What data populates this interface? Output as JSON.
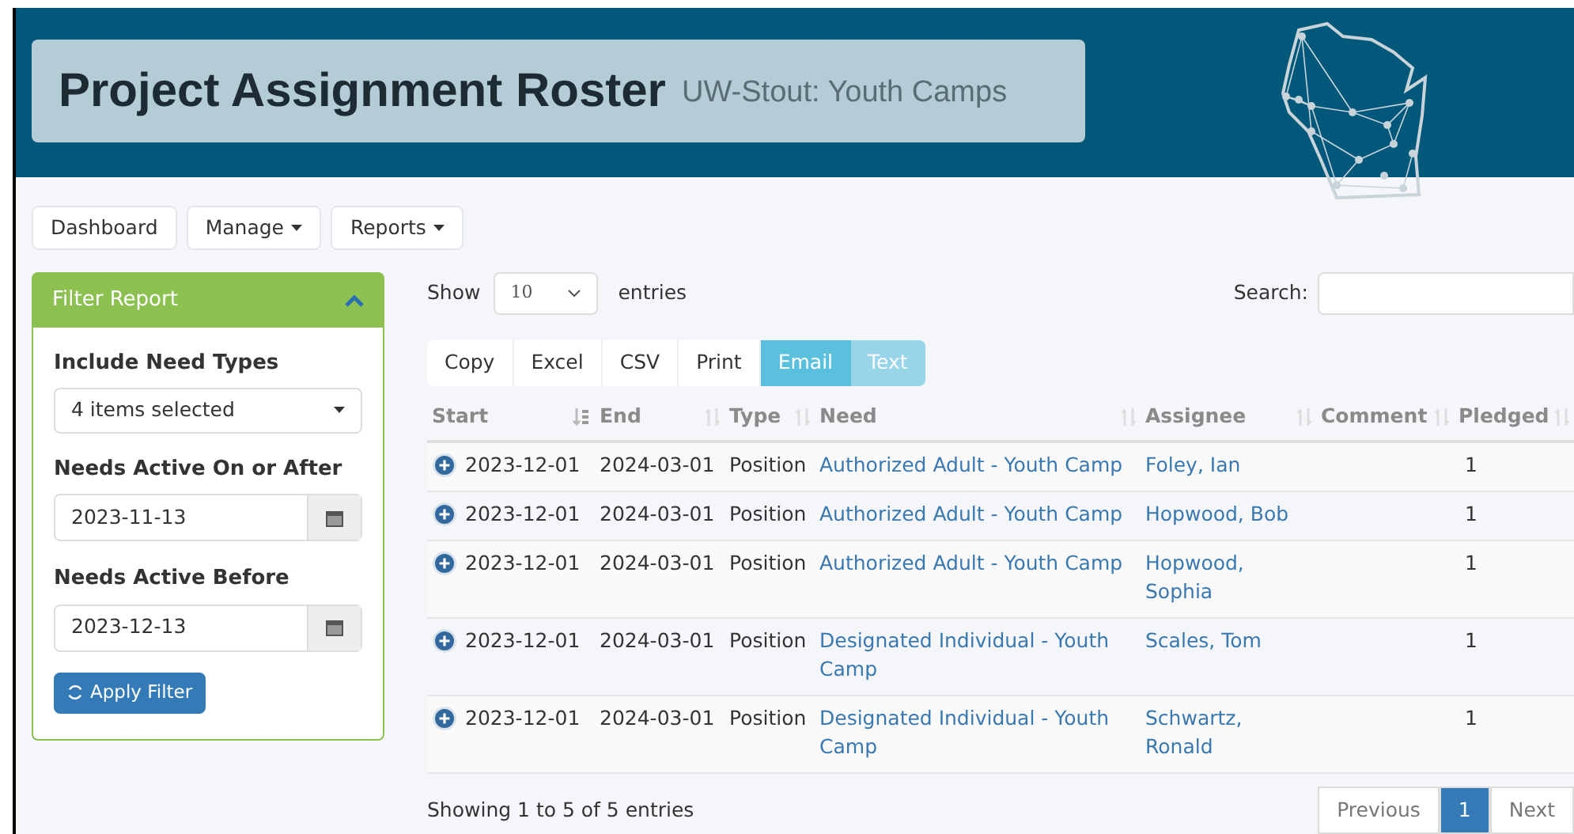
{
  "header": {
    "title": "Project Assignment Roster",
    "subtitle": "UW-Stout: Youth Camps"
  },
  "nav": [
    {
      "label": "Dashboard",
      "dropdown": false
    },
    {
      "label": "Manage",
      "dropdown": true
    },
    {
      "label": "Reports",
      "dropdown": true
    }
  ],
  "filter": {
    "title": "Filter Report",
    "expanded": true,
    "need_types_label": "Include Need Types",
    "need_types_value": "4 items selected",
    "after_label": "Needs Active On or After",
    "after_value": "2023-11-13",
    "before_label": "Needs Active Before",
    "before_value": "2023-12-13",
    "apply_button": "Apply Filter"
  },
  "length": {
    "show": "Show",
    "value": "10",
    "entries": "entries"
  },
  "search": {
    "label": "Search:"
  },
  "export_buttons": [
    {
      "label": "Copy",
      "kind": "plain",
      "disabled": false
    },
    {
      "label": "Excel",
      "kind": "plain",
      "disabled": false
    },
    {
      "label": "CSV",
      "kind": "plain",
      "disabled": false
    },
    {
      "label": "Print",
      "kind": "plain",
      "disabled": false
    },
    {
      "label": "Email",
      "kind": "info",
      "disabled": false
    },
    {
      "label": "Text",
      "kind": "info",
      "disabled": true
    }
  ],
  "table": {
    "columns": [
      {
        "label": "Start",
        "sorted": true
      },
      {
        "label": "End",
        "sorted": false
      },
      {
        "label": "Type",
        "sorted": false
      },
      {
        "label": "Need",
        "sorted": false
      },
      {
        "label": "Assignee",
        "sorted": false
      },
      {
        "label": "Comment",
        "sorted": false
      },
      {
        "label": "Pledged",
        "sorted": false
      }
    ],
    "rows": [
      {
        "start": "2023-12-01",
        "end": "2024-03-01",
        "type": "Position",
        "need": "Authorized Adult - Youth Camp",
        "assignee": "Foley, Ian",
        "pledged": "1"
      },
      {
        "start": "2023-12-01",
        "end": "2024-03-01",
        "type": "Position",
        "need": "Authorized Adult - Youth Camp",
        "assignee": "Hopwood, Bob",
        "pledged": "1"
      },
      {
        "start": "2023-12-01",
        "end": "2024-03-01",
        "type": "Position",
        "need": "Authorized Adult - Youth Camp",
        "assignee": "Hopwood, Sophia",
        "pledged": "1"
      },
      {
        "start": "2023-12-01",
        "end": "2024-03-01",
        "type": "Position",
        "need": "Designated Individual - Youth Camp",
        "assignee": "Scales, Tom",
        "pledged": "1"
      },
      {
        "start": "2023-12-01",
        "end": "2024-03-01",
        "type": "Position",
        "need": "Designated Individual - Youth Camp",
        "assignee": "Schwartz, Ronald",
        "pledged": "1"
      }
    ]
  },
  "info": "Showing 1 to 5 of 5 entries",
  "pagination": [
    {
      "label": "Previous",
      "selected": false
    },
    {
      "label": "1",
      "selected": true
    },
    {
      "label": "Next",
      "selected": false
    }
  ]
}
